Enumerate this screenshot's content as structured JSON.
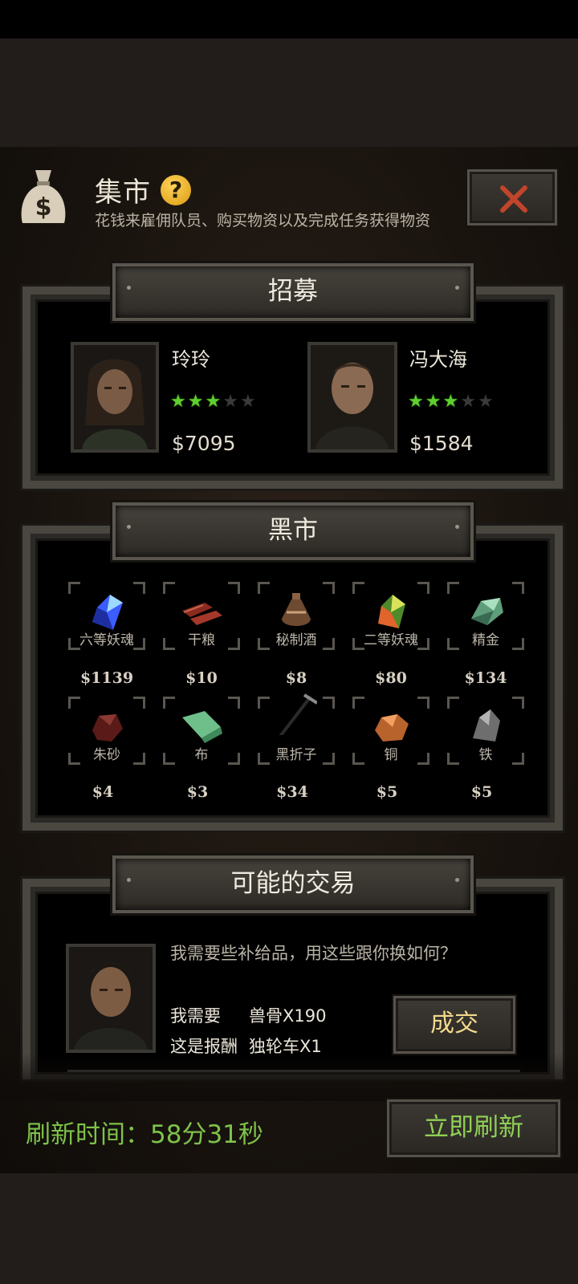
{
  "header": {
    "title": "集市",
    "help_symbol": "?",
    "subtitle": "花钱来雇佣队员、购买物资以及完成任务获得物资",
    "icons": {
      "bag": "money-bag-icon",
      "help": "question-icon",
      "close": "close-icon"
    }
  },
  "recruit": {
    "title": "招募",
    "members": [
      {
        "name": "玲玲",
        "stars": 3,
        "max_stars": 5,
        "price": "$7095"
      },
      {
        "name": "冯大海",
        "stars": 3,
        "max_stars": 5,
        "price": "$1584"
      }
    ]
  },
  "market": {
    "title": "黑市",
    "items": [
      {
        "name": "六等妖魂",
        "price": "$1139",
        "icon": "blue-crystal-icon"
      },
      {
        "name": "干粮",
        "price": "$10",
        "icon": "jerky-icon"
      },
      {
        "name": "秘制酒",
        "price": "$8",
        "icon": "wine-jar-icon"
      },
      {
        "name": "二等妖魂",
        "price": "$80",
        "icon": "green-crystal-icon"
      },
      {
        "name": "精金",
        "price": "$134",
        "icon": "ore-icon"
      },
      {
        "name": "朱砂",
        "price": "$4",
        "icon": "cinnabar-icon"
      },
      {
        "name": "布",
        "price": "$3",
        "icon": "cloth-icon"
      },
      {
        "name": "黑折子",
        "price": "$34",
        "icon": "pickaxe-icon"
      },
      {
        "name": "铜",
        "price": "$5",
        "icon": "copper-ore-icon"
      },
      {
        "name": "铁",
        "price": "$5",
        "icon": "iron-ore-icon"
      }
    ]
  },
  "trade": {
    "title": "可能的交易",
    "question": "我需要些补给品，用这些跟你换如何？",
    "need_label": "我需要",
    "need_value": "兽骨X190",
    "reward_label": "这是报酬",
    "reward_value": "独轮车X1",
    "deal_label": "成交"
  },
  "footer": {
    "refresh_time": "刷新时间：58分31秒",
    "refresh_button": "立即刷新"
  }
}
